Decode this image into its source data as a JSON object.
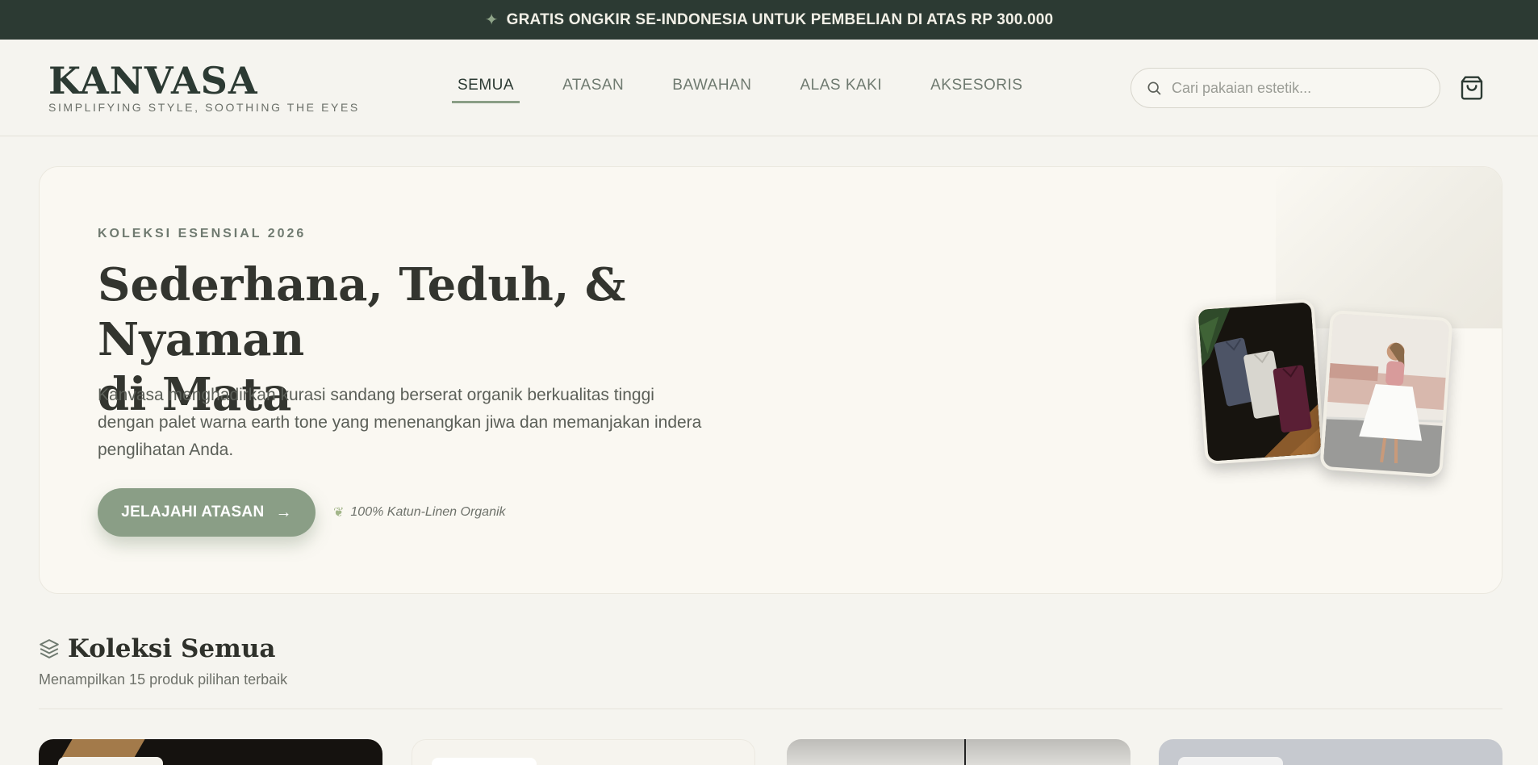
{
  "announcement": {
    "text": "GRATIS ONGKIR SE-INDONESIA UNTUK PEMBELIAN DI ATAS RP 300.000",
    "icon": "sparkle-icon"
  },
  "brand": {
    "logo": "KANVASA",
    "tagline": "SIMPLIFYING STYLE, SOOTHING THE EYES"
  },
  "nav": {
    "items": [
      {
        "label": "SEMUA",
        "active": true
      },
      {
        "label": "ATASAN",
        "active": false
      },
      {
        "label": "BAWAHAN",
        "active": false
      },
      {
        "label": "ALAS KAKI",
        "active": false
      },
      {
        "label": "AKSESORIS",
        "active": false
      }
    ]
  },
  "search": {
    "placeholder": "Cari pakaian estetik...",
    "value": "",
    "icon": "search-icon"
  },
  "cart": {
    "icon": "shopping-bag-icon"
  },
  "hero": {
    "eyebrow": "KOLEKSI ESENSIAL 2026",
    "title_line1": "Sederhana, Teduh, & Nyaman",
    "title_line2": "di Mata",
    "description": "Kanvasa menghadirkan kurasi sandang berserat organik berkualitas tinggi dengan palet warna earth tone yang menenangkan jiwa dan memanjakan indera penglihatan Anda.",
    "cta_label": "JELAJAHI ATASAN",
    "badge": "100% Katun-Linen Organik",
    "images": [
      "folded-shirts-photo",
      "woman-white-skirt-photo"
    ]
  },
  "section": {
    "title": "Koleksi Semua",
    "subtitle": "Menampilkan 15 produk pilihan terbaik",
    "icon": "layers-icon"
  },
  "colors": {
    "topbar": "#2c3a33",
    "accent": "#8a9e86",
    "background": "#f5f4ef",
    "hero_bg": "#faf8f2",
    "text_dark": "#33352f"
  }
}
